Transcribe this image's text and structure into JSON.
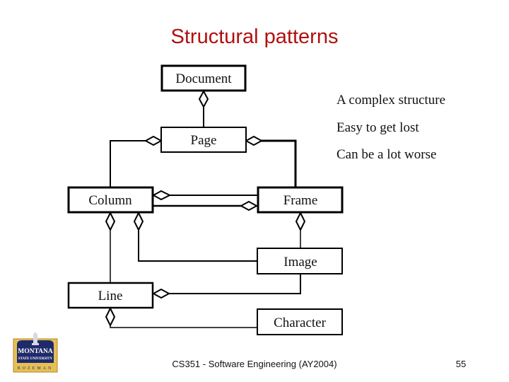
{
  "slide": {
    "title": "Structural patterns",
    "bullets": [
      "A complex structure",
      "Easy to get lost",
      "Can be a lot worse"
    ],
    "footer": "CS351 - Software Engineering (AY2004)",
    "page_number": "55",
    "logo": {
      "name": "montana-state-university-logo",
      "line1": "MONTANA",
      "line2": "STATE UNIVERSITY",
      "line3": "BOZEMAN",
      "colors": {
        "navy": "#1f2a6b",
        "gold": "#e0b440",
        "white": "#ffffff"
      }
    }
  },
  "diagram": {
    "type": "uml-class-aggregation",
    "classes": [
      {
        "id": "document",
        "label": "Document"
      },
      {
        "id": "page",
        "label": "Page"
      },
      {
        "id": "column",
        "label": "Column"
      },
      {
        "id": "frame",
        "label": "Frame"
      },
      {
        "id": "image",
        "label": "Image"
      },
      {
        "id": "line",
        "label": "Line"
      },
      {
        "id": "character",
        "label": "Character"
      }
    ],
    "aggregations": [
      {
        "whole": "Document",
        "part": "Page"
      },
      {
        "whole": "Page",
        "part": "Column"
      },
      {
        "whole": "Page",
        "part": "Frame"
      },
      {
        "whole": "Column",
        "part": "Frame"
      },
      {
        "whole": "Frame",
        "part": "Column"
      },
      {
        "whole": "Column",
        "part": "Line"
      },
      {
        "whole": "Column",
        "part": "Image"
      },
      {
        "whole": "Frame",
        "part": "Image"
      },
      {
        "whole": "Line",
        "part": "Image"
      },
      {
        "whole": "Line",
        "part": "Character"
      }
    ]
  },
  "colors": {
    "title": "#b01010",
    "text": "#111111",
    "background": "#ffffff"
  }
}
